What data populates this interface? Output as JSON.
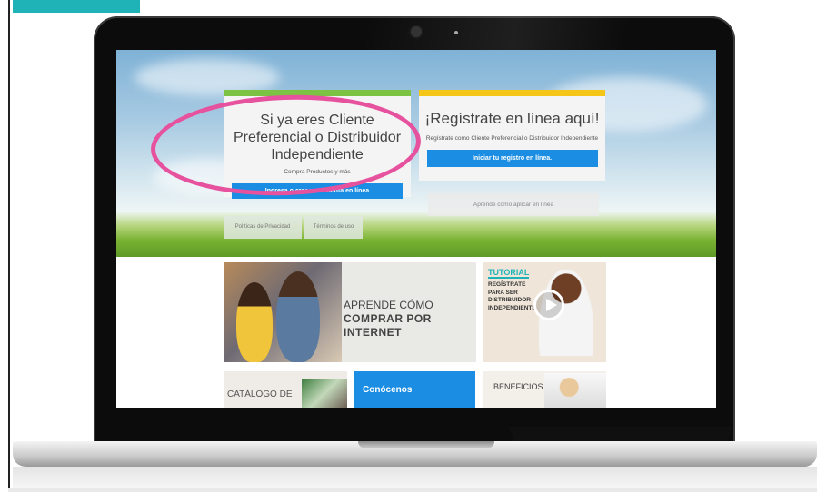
{
  "hero": {
    "left_card": {
      "title": "Si ya eres Cliente Preferencial o Distribuidor Independiente",
      "subtitle": "Compra Productos y más",
      "button": "Ingresa o crea una cuenta en línea"
    },
    "right_card": {
      "title": "¡Regístrate en línea aquí!",
      "subtitle": "Regístrate como Cliente Preferencial o Distribuidor Independiente",
      "button": "Iniciar tu registro en línea."
    },
    "learn_button": "Aprende cómo aplicar en línea",
    "links": [
      "Políticas de Privacidad",
      "Términos de uso"
    ]
  },
  "tiles": {
    "learn": {
      "line1": "APRENDE CÓMO",
      "line2": "COMPRAR POR INTERNET"
    },
    "tutorial": {
      "title": "TUTORIAL",
      "text": "REGÍSTRATE PARA SER DISTRIBUIDOR INDEPENDIENTE"
    },
    "catalog": "CATÁLOGO DE",
    "conocenos": "Conócenos",
    "benefits": "BENEFICIOS DEL"
  },
  "colors": {
    "accent_blue": "#1b8ee3",
    "green_bar": "#7cc243",
    "yellow_bar": "#f5c518",
    "highlight": "#e6529e",
    "teal": "#1fb3b8"
  }
}
